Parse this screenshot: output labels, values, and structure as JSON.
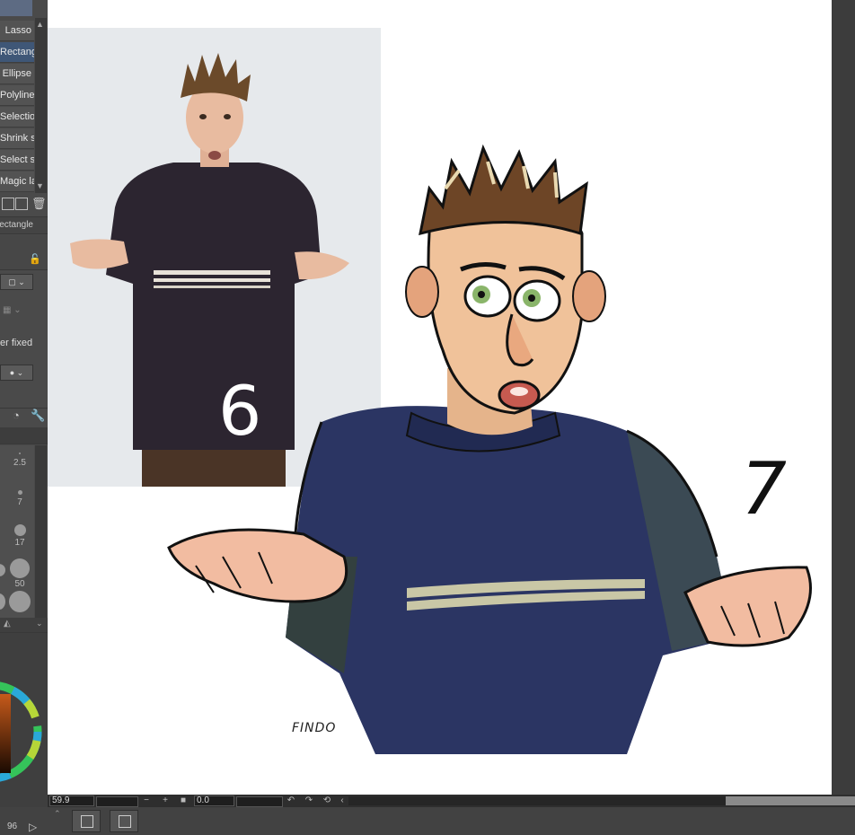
{
  "tools": {
    "items": [
      {
        "label": "Lasso",
        "active": false
      },
      {
        "label": "Rectangle",
        "active": true
      },
      {
        "label": "Ellipse",
        "active": false
      },
      {
        "label": "Polyline",
        "active": false
      },
      {
        "label": "Selection pen",
        "active": false
      },
      {
        "label": "Shrink selection",
        "active": false
      },
      {
        "label": "Select selection",
        "active": false
      },
      {
        "label": "Magic lasso",
        "active": false
      }
    ],
    "subtool_label": "Rectangle",
    "aspect_label": "er fixed"
  },
  "brush_sizes": [
    "2.5",
    "7",
    "17",
    "50"
  ],
  "canvas": {
    "left_number": "6",
    "right_number": "7",
    "signature": "FINDO"
  },
  "bottom_bar": {
    "zoom": "59.9",
    "angle": "0.0",
    "minus": "−",
    "plus": "+"
  },
  "status": {
    "bottom_left": "96"
  },
  "colors": {
    "accent": "#3f5777",
    "panel": "#4a4a4a",
    "sweater_photo": "#2c2530",
    "sweater_drawn": "#2b3563"
  }
}
